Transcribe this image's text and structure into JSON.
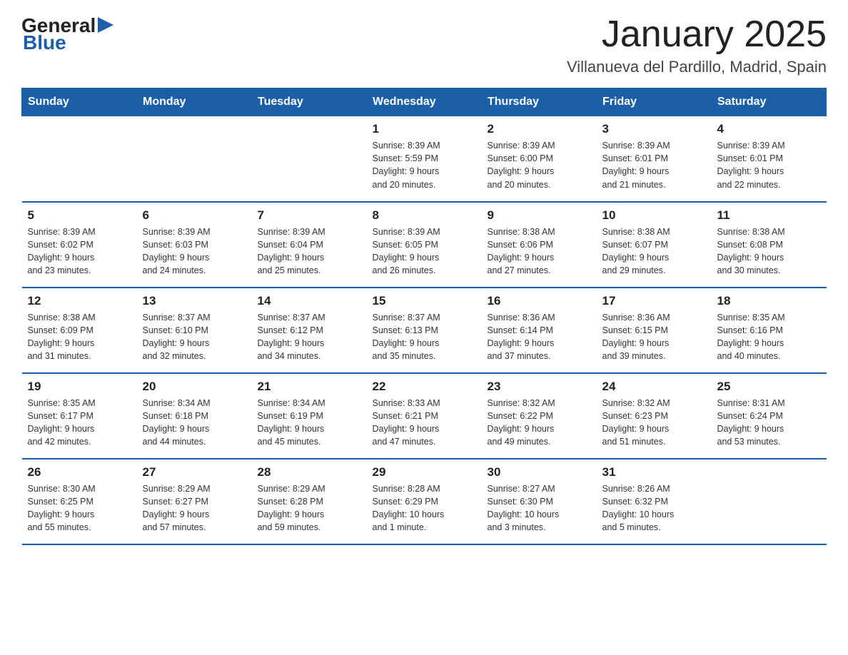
{
  "header": {
    "logo_general": "General",
    "logo_blue": "Blue",
    "title": "January 2025",
    "subtitle": "Villanueva del Pardillo, Madrid, Spain"
  },
  "days_of_week": [
    "Sunday",
    "Monday",
    "Tuesday",
    "Wednesday",
    "Thursday",
    "Friday",
    "Saturday"
  ],
  "weeks": [
    [
      {
        "day": "",
        "info": ""
      },
      {
        "day": "",
        "info": ""
      },
      {
        "day": "",
        "info": ""
      },
      {
        "day": "1",
        "info": "Sunrise: 8:39 AM\nSunset: 5:59 PM\nDaylight: 9 hours\nand 20 minutes."
      },
      {
        "day": "2",
        "info": "Sunrise: 8:39 AM\nSunset: 6:00 PM\nDaylight: 9 hours\nand 20 minutes."
      },
      {
        "day": "3",
        "info": "Sunrise: 8:39 AM\nSunset: 6:01 PM\nDaylight: 9 hours\nand 21 minutes."
      },
      {
        "day": "4",
        "info": "Sunrise: 8:39 AM\nSunset: 6:01 PM\nDaylight: 9 hours\nand 22 minutes."
      }
    ],
    [
      {
        "day": "5",
        "info": "Sunrise: 8:39 AM\nSunset: 6:02 PM\nDaylight: 9 hours\nand 23 minutes."
      },
      {
        "day": "6",
        "info": "Sunrise: 8:39 AM\nSunset: 6:03 PM\nDaylight: 9 hours\nand 24 minutes."
      },
      {
        "day": "7",
        "info": "Sunrise: 8:39 AM\nSunset: 6:04 PM\nDaylight: 9 hours\nand 25 minutes."
      },
      {
        "day": "8",
        "info": "Sunrise: 8:39 AM\nSunset: 6:05 PM\nDaylight: 9 hours\nand 26 minutes."
      },
      {
        "day": "9",
        "info": "Sunrise: 8:38 AM\nSunset: 6:06 PM\nDaylight: 9 hours\nand 27 minutes."
      },
      {
        "day": "10",
        "info": "Sunrise: 8:38 AM\nSunset: 6:07 PM\nDaylight: 9 hours\nand 29 minutes."
      },
      {
        "day": "11",
        "info": "Sunrise: 8:38 AM\nSunset: 6:08 PM\nDaylight: 9 hours\nand 30 minutes."
      }
    ],
    [
      {
        "day": "12",
        "info": "Sunrise: 8:38 AM\nSunset: 6:09 PM\nDaylight: 9 hours\nand 31 minutes."
      },
      {
        "day": "13",
        "info": "Sunrise: 8:37 AM\nSunset: 6:10 PM\nDaylight: 9 hours\nand 32 minutes."
      },
      {
        "day": "14",
        "info": "Sunrise: 8:37 AM\nSunset: 6:12 PM\nDaylight: 9 hours\nand 34 minutes."
      },
      {
        "day": "15",
        "info": "Sunrise: 8:37 AM\nSunset: 6:13 PM\nDaylight: 9 hours\nand 35 minutes."
      },
      {
        "day": "16",
        "info": "Sunrise: 8:36 AM\nSunset: 6:14 PM\nDaylight: 9 hours\nand 37 minutes."
      },
      {
        "day": "17",
        "info": "Sunrise: 8:36 AM\nSunset: 6:15 PM\nDaylight: 9 hours\nand 39 minutes."
      },
      {
        "day": "18",
        "info": "Sunrise: 8:35 AM\nSunset: 6:16 PM\nDaylight: 9 hours\nand 40 minutes."
      }
    ],
    [
      {
        "day": "19",
        "info": "Sunrise: 8:35 AM\nSunset: 6:17 PM\nDaylight: 9 hours\nand 42 minutes."
      },
      {
        "day": "20",
        "info": "Sunrise: 8:34 AM\nSunset: 6:18 PM\nDaylight: 9 hours\nand 44 minutes."
      },
      {
        "day": "21",
        "info": "Sunrise: 8:34 AM\nSunset: 6:19 PM\nDaylight: 9 hours\nand 45 minutes."
      },
      {
        "day": "22",
        "info": "Sunrise: 8:33 AM\nSunset: 6:21 PM\nDaylight: 9 hours\nand 47 minutes."
      },
      {
        "day": "23",
        "info": "Sunrise: 8:32 AM\nSunset: 6:22 PM\nDaylight: 9 hours\nand 49 minutes."
      },
      {
        "day": "24",
        "info": "Sunrise: 8:32 AM\nSunset: 6:23 PM\nDaylight: 9 hours\nand 51 minutes."
      },
      {
        "day": "25",
        "info": "Sunrise: 8:31 AM\nSunset: 6:24 PM\nDaylight: 9 hours\nand 53 minutes."
      }
    ],
    [
      {
        "day": "26",
        "info": "Sunrise: 8:30 AM\nSunset: 6:25 PM\nDaylight: 9 hours\nand 55 minutes."
      },
      {
        "day": "27",
        "info": "Sunrise: 8:29 AM\nSunset: 6:27 PM\nDaylight: 9 hours\nand 57 minutes."
      },
      {
        "day": "28",
        "info": "Sunrise: 8:29 AM\nSunset: 6:28 PM\nDaylight: 9 hours\nand 59 minutes."
      },
      {
        "day": "29",
        "info": "Sunrise: 8:28 AM\nSunset: 6:29 PM\nDaylight: 10 hours\nand 1 minute."
      },
      {
        "day": "30",
        "info": "Sunrise: 8:27 AM\nSunset: 6:30 PM\nDaylight: 10 hours\nand 3 minutes."
      },
      {
        "day": "31",
        "info": "Sunrise: 8:26 AM\nSunset: 6:32 PM\nDaylight: 10 hours\nand 5 minutes."
      },
      {
        "day": "",
        "info": ""
      }
    ]
  ]
}
